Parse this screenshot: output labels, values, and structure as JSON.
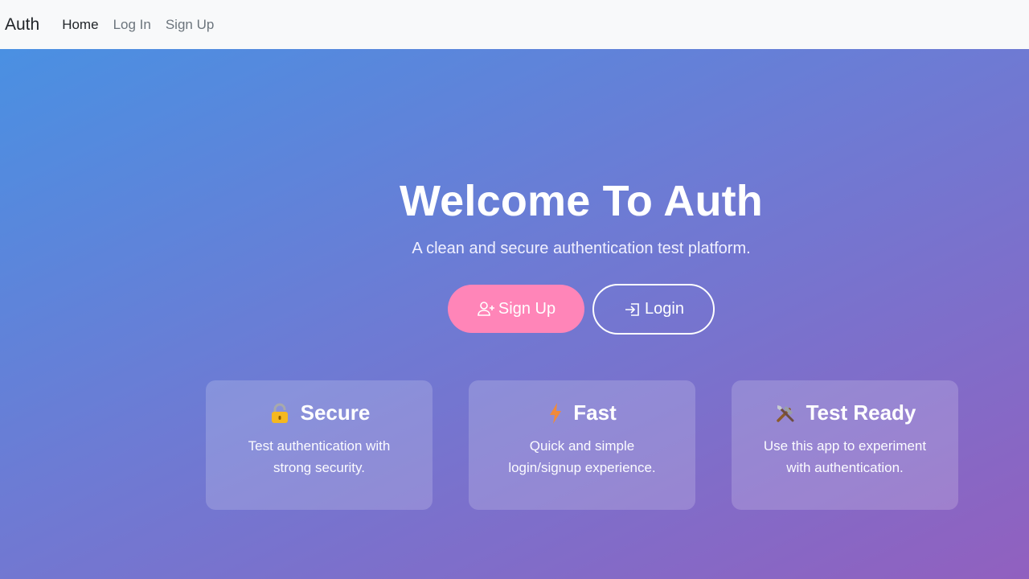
{
  "nav": {
    "brand": "Auth",
    "links": [
      "Home",
      "Log In",
      "Sign Up"
    ]
  },
  "hero": {
    "title": "Welcome To Auth",
    "subtitle": "A clean and secure authentication test platform.",
    "signup_label": "Sign Up",
    "login_label": "Login"
  },
  "features": [
    {
      "icon": "lock-icon",
      "title": "Secure",
      "desc": "Test authentication with strong security."
    },
    {
      "icon": "lightning-icon",
      "title": "Fast",
      "desc": "Quick and simple login/signup experience."
    },
    {
      "icon": "tools-icon",
      "title": "Test Ready",
      "desc": "Use this app to experiment with authentication."
    }
  ],
  "colors": {
    "gradient_start": "#4a90e2",
    "gradient_end": "#9160bf",
    "signup_button": "#ff85b8"
  }
}
